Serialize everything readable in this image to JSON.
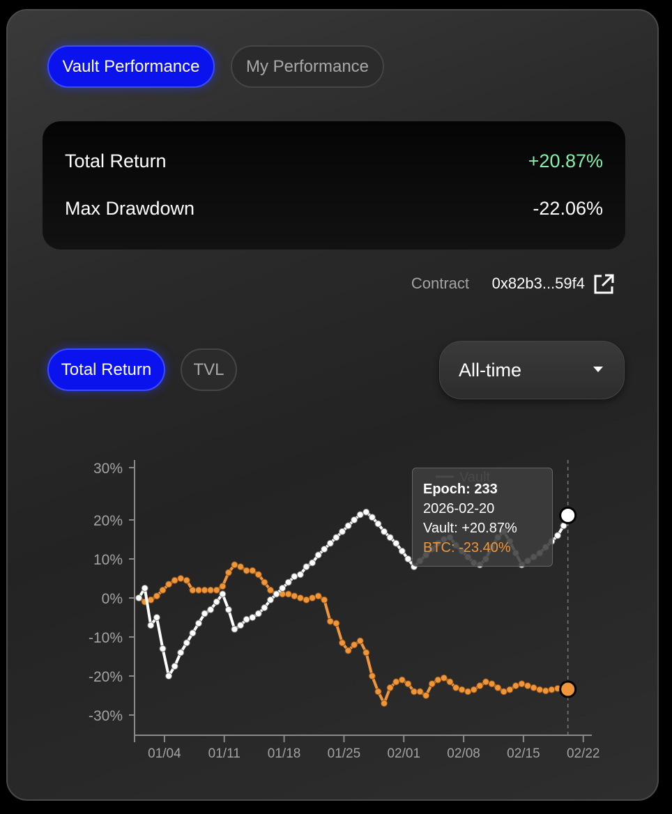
{
  "tabs": {
    "vault_performance": "Vault Performance",
    "my_performance": "My Performance"
  },
  "stats": {
    "total_return_label": "Total Return",
    "total_return_value": "+20.87%",
    "max_drawdown_label": "Max Drawdown",
    "max_drawdown_value": "-22.06%"
  },
  "contract": {
    "label": "Contract",
    "address": "0x82b3...59f4"
  },
  "chart_tabs": {
    "total_return": "Total Return",
    "tvl": "TVL"
  },
  "range_select": {
    "selected": "All-time"
  },
  "tooltip": {
    "epoch": "Epoch: 233",
    "date": "2026-02-20",
    "vault": "Vault: +20.87%",
    "btc": "BTC: -23.40%"
  },
  "colors": {
    "accent": "#0a12ee",
    "positive": "#86efac",
    "vault_line": "#ffffff",
    "btc_line": "#f0963a"
  },
  "chart_data": {
    "type": "line",
    "legend": [
      "Vault"
    ],
    "y_ticks": [
      "30%",
      "20%",
      "10%",
      "0%",
      "-10%",
      "-20%",
      "-30%"
    ],
    "y_tick_values": [
      30,
      20,
      10,
      0,
      -10,
      -20,
      -30
    ],
    "x_ticks": [
      "01/04",
      "01/11",
      "01/18",
      "01/25",
      "02/01",
      "02/08",
      "02/15",
      "02/22"
    ],
    "x_tick_days": [
      4,
      11,
      18,
      25,
      32,
      39,
      46,
      53
    ],
    "x_unit": "days since 2026-01-01",
    "ylim": [
      -35,
      32
    ],
    "xlim": [
      0.5,
      54
    ],
    "series": [
      {
        "name": "Vault",
        "color": "#ffffff",
        "x": [
          1,
          1.7,
          2.4,
          3.1,
          3.8,
          4.5,
          5.2,
          5.9,
          6.6,
          7.3,
          8.0,
          8.7,
          9.4,
          10.1,
          10.8,
          11.5,
          12.2,
          12.9,
          13.6,
          14.3,
          15.0,
          15.7,
          16.4,
          17.1,
          17.8,
          18.5,
          19.2,
          19.9,
          20.6,
          21.3,
          22.0,
          22.7,
          23.4,
          24.1,
          24.8,
          25.5,
          26.2,
          26.9,
          27.6,
          28.3,
          29.0,
          29.7,
          30.4,
          31.1,
          31.8,
          32.5,
          33.2,
          33.9,
          34.6,
          35.3,
          36.0,
          36.7,
          37.4,
          38.1,
          38.8,
          39.5,
          40.2,
          40.9,
          41.6,
          42.3,
          43.0,
          43.7,
          44.4,
          45.1,
          45.8,
          46.5,
          47.2,
          47.9,
          48.6,
          49.3,
          50.0,
          50.7,
          51.2
        ],
        "values": [
          0,
          2.5,
          -7,
          -5,
          -13,
          -20,
          -17.5,
          -14,
          -11.5,
          -9,
          -6.5,
          -4,
          -3,
          -1,
          1,
          -3,
          -8,
          -7,
          -5.5,
          -5,
          -4,
          -2.5,
          -0.5,
          1,
          2.5,
          4,
          5.5,
          6,
          8,
          9,
          11,
          12.5,
          14,
          15.5,
          17,
          18.5,
          20,
          21,
          21.5,
          20.5,
          19,
          17,
          15.5,
          14,
          12,
          10,
          8,
          9.5,
          11,
          12.5,
          14,
          15,
          15.5,
          13.5,
          12,
          10.5,
          9,
          8.5,
          10,
          13,
          15.5,
          17,
          14.5,
          11.5,
          8.5,
          9.5,
          10.5,
          11.5,
          13,
          14.5,
          16,
          18.5,
          20.87
        ]
      },
      {
        "name": "BTC",
        "color": "#f0963a",
        "x": [
          1,
          1.7,
          2.4,
          3.1,
          3.8,
          4.5,
          5.2,
          5.9,
          6.6,
          7.3,
          8.0,
          8.7,
          9.4,
          10.1,
          10.8,
          11.5,
          12.2,
          12.9,
          13.6,
          14.3,
          15.0,
          15.7,
          16.4,
          17.1,
          17.8,
          18.5,
          19.2,
          19.9,
          20.6,
          21.3,
          22.0,
          22.7,
          23.4,
          24.1,
          24.8,
          25.5,
          26.2,
          26.9,
          27.6,
          28.3,
          29.0,
          29.7,
          30.4,
          31.1,
          31.8,
          32.5,
          33.2,
          33.9,
          34.6,
          35.3,
          36.0,
          36.7,
          37.4,
          38.1,
          38.8,
          39.5,
          40.2,
          40.9,
          41.6,
          42.3,
          43.0,
          43.7,
          44.4,
          45.1,
          45.8,
          46.5,
          47.2,
          47.9,
          48.6,
          49.3,
          50.0,
          50.7,
          51.2
        ],
        "values": [
          0,
          -1,
          -0.5,
          0.5,
          2,
          3.5,
          4.5,
          5,
          4.5,
          2,
          2,
          2,
          2,
          2,
          3,
          6.5,
          8.5,
          8,
          7,
          7,
          6,
          4,
          2,
          1,
          1,
          1,
          0.5,
          0,
          -0.5,
          0,
          0.5,
          -0.5,
          -6,
          -6.5,
          -11.5,
          -13.5,
          -12,
          -11,
          -14,
          -20,
          -24,
          -27,
          -23,
          -21.5,
          -21,
          -22,
          -24,
          -24,
          -25,
          -22,
          -21,
          -20.5,
          -21.5,
          -23,
          -23.5,
          -24,
          -23.5,
          -22.5,
          -21.5,
          -22,
          -23,
          -24,
          -23.5,
          -22.5,
          -22,
          -22.5,
          -23,
          -23.5,
          -23.8,
          -23.5,
          -23.2,
          -23.3,
          -23.4
        ]
      }
    ],
    "hover_x": 51.2
  }
}
